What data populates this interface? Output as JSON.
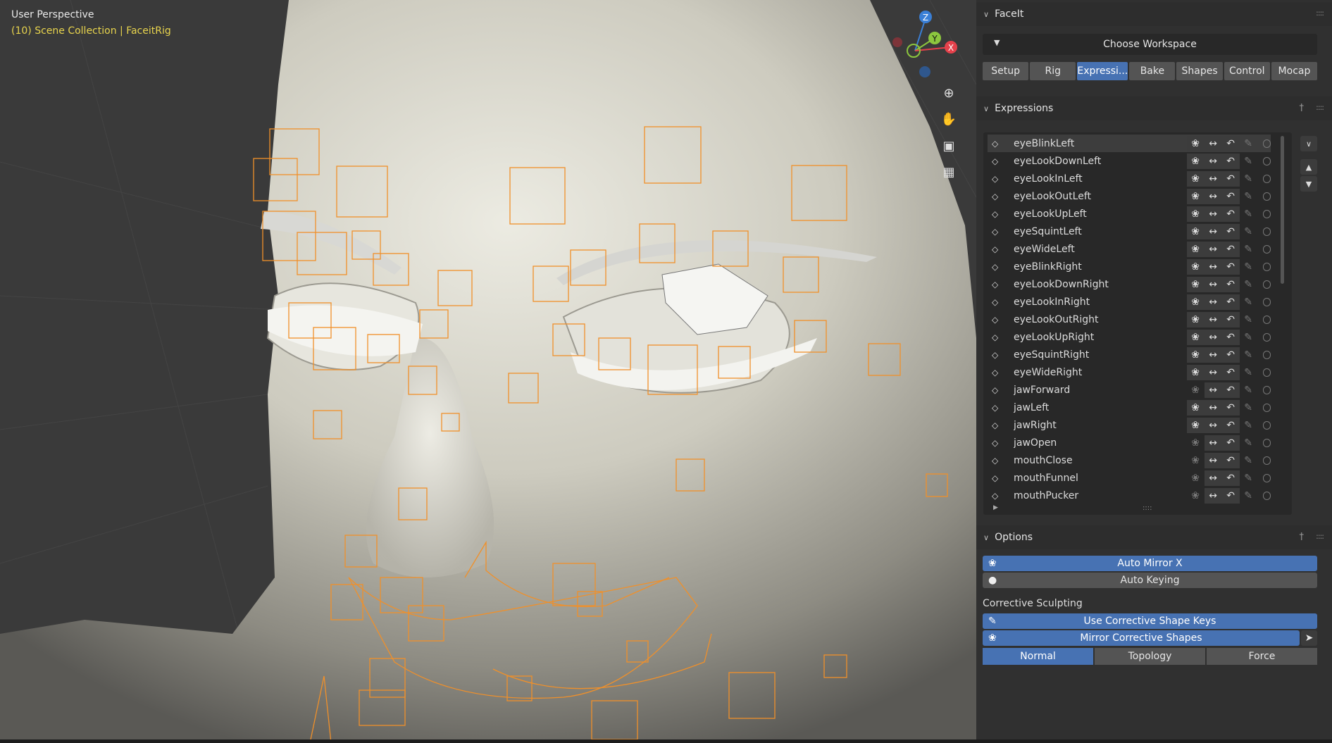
{
  "viewport": {
    "title": "User Perspective",
    "collection": "(10) Scene Collection | FaceitRig",
    "gizmo": {
      "z": "Z",
      "y": "Y",
      "x": "X"
    },
    "nav_icons": [
      "zoom-icon",
      "hand-icon",
      "camera-icon",
      "grid-icon"
    ]
  },
  "faceit": {
    "title": "FaceIt",
    "workspace_label": "Choose Workspace",
    "tabs": [
      "Setup",
      "Rig",
      "Expressi...",
      "Bake",
      "Shapes",
      "Control",
      "Mocap"
    ],
    "active_tab": 2
  },
  "expressions": {
    "title": "Expressions",
    "items": [
      "eyeBlinkLeft",
      "eyeLookDownLeft",
      "eyeLookInLeft",
      "eyeLookOutLeft",
      "eyeLookUpLeft",
      "eyeSquintLeft",
      "eyeWideLeft",
      "eyeBlinkRight",
      "eyeLookDownRight",
      "eyeLookInRight",
      "eyeLookOutRight",
      "eyeLookUpRight",
      "eyeSquintRight",
      "eyeWideRight",
      "jawForward",
      "jawLeft",
      "jawRight",
      "jawOpen",
      "mouthClose",
      "mouthFunnel",
      "mouthPucker"
    ],
    "selected": 0,
    "mirror_active": [
      true,
      true,
      true,
      true,
      true,
      true,
      true,
      true,
      true,
      true,
      true,
      true,
      true,
      true,
      false,
      true,
      true,
      false,
      false,
      false,
      false
    ]
  },
  "options": {
    "title": "Options",
    "auto_mirror_label": "Auto Mirror X",
    "auto_keying_label": "Auto Keying",
    "corrective_label": "Corrective Sculpting",
    "use_corrective_label": "Use Corrective Shape Keys",
    "mirror_corrective_label": "Mirror Corrective Shapes",
    "modes": [
      "Normal",
      "Topology",
      "Force"
    ],
    "active_mode": 0
  },
  "colors": {
    "accent": "#4772b3",
    "wire": "#f0902a",
    "collection_text": "#e8d44d"
  }
}
